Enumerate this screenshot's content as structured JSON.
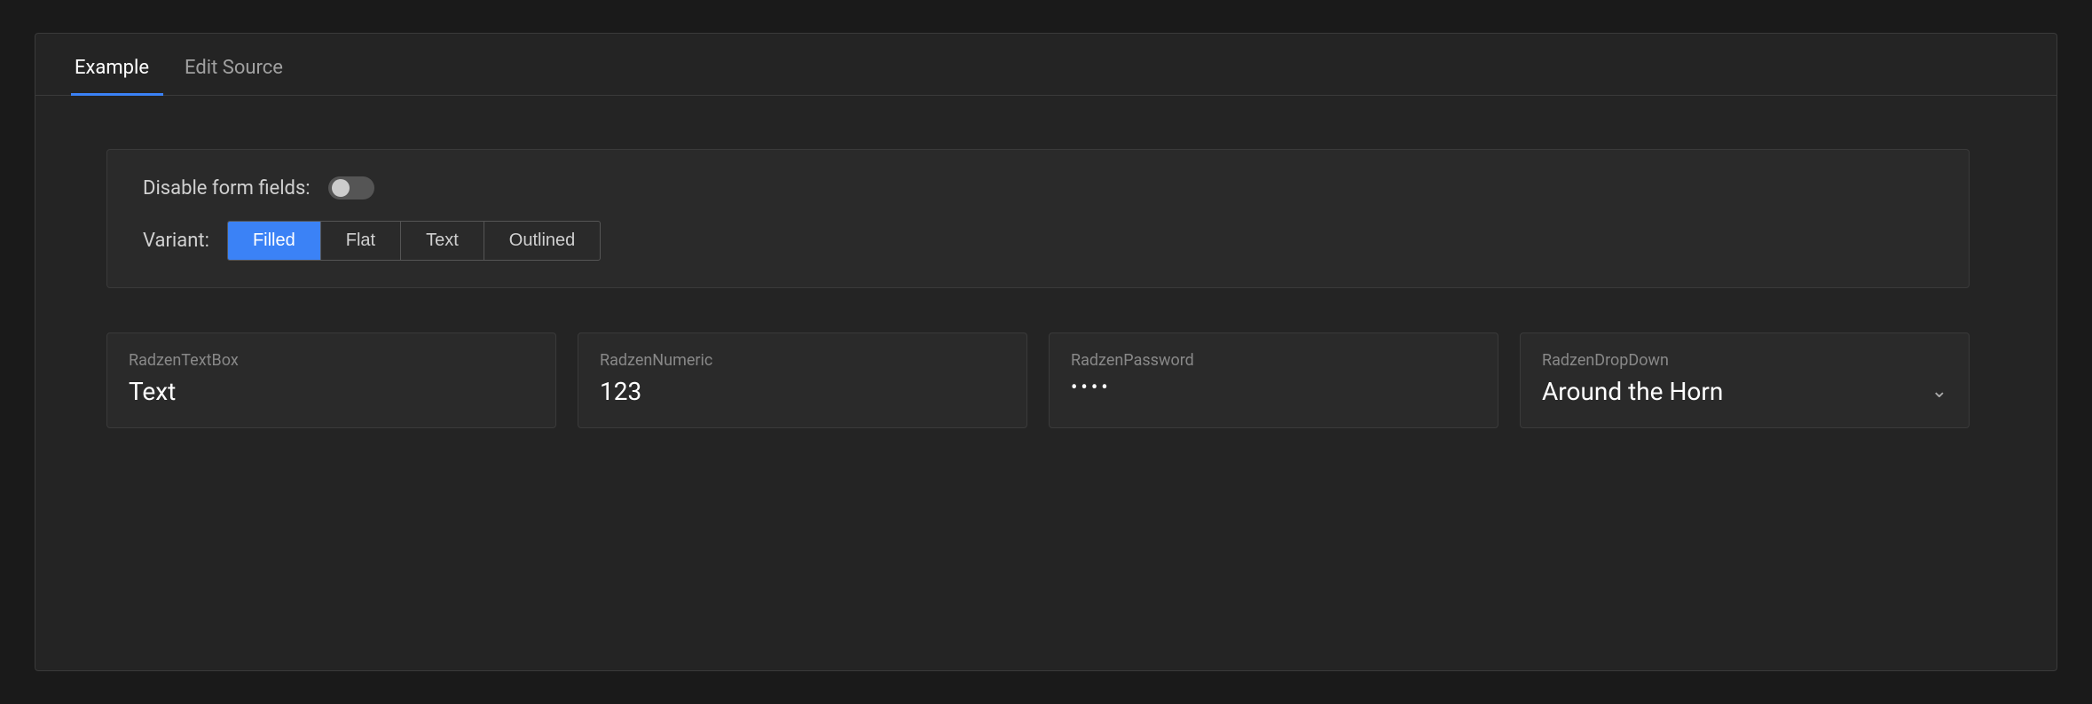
{
  "tabs": [
    {
      "id": "example",
      "label": "Example",
      "active": true
    },
    {
      "id": "edit-source",
      "label": "Edit Source",
      "active": false
    }
  ],
  "options": {
    "disable_fields_label": "Disable form fields:",
    "toggle_state": false,
    "variant_label": "Variant:",
    "variants": [
      {
        "id": "filled",
        "label": "Filled",
        "active": true
      },
      {
        "id": "flat",
        "label": "Flat",
        "active": false
      },
      {
        "id": "text",
        "label": "Text",
        "active": false
      },
      {
        "id": "outlined",
        "label": "Outlined",
        "active": false
      }
    ]
  },
  "fields": [
    {
      "type_label": "RadzenTextBox",
      "value": "Text",
      "kind": "text"
    },
    {
      "type_label": "RadzenNumeric",
      "value": "123",
      "kind": "numeric"
    },
    {
      "type_label": "RadzenPassword",
      "value": "••••",
      "kind": "password"
    },
    {
      "type_label": "RadzenDropDown",
      "value": "Around the Horn",
      "kind": "dropdown"
    }
  ],
  "icons": {
    "chevron_down": "&#x2304;"
  }
}
